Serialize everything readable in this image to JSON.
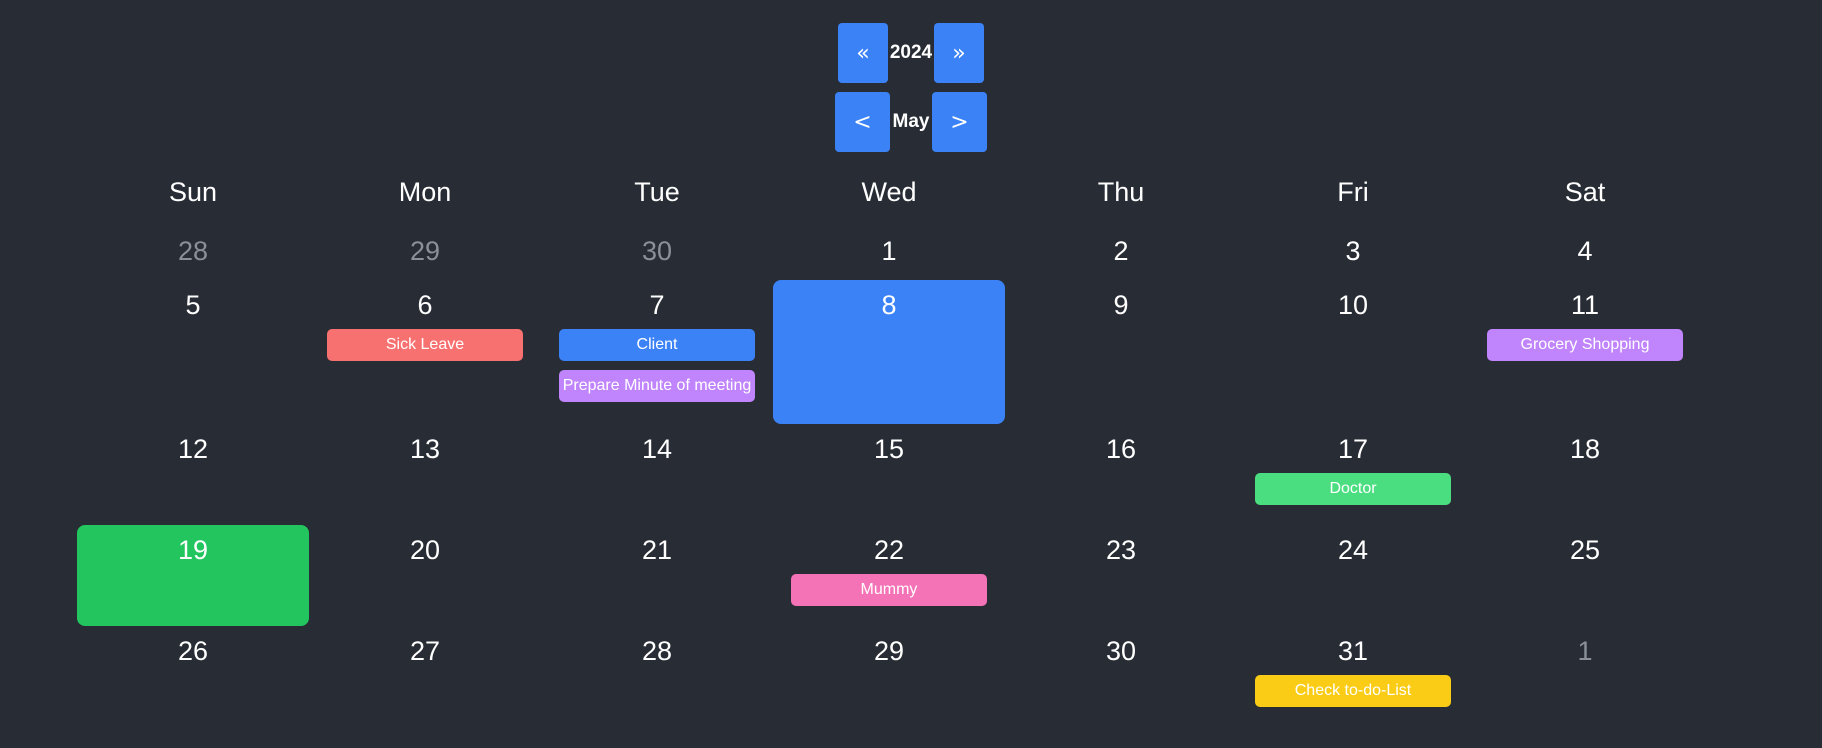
{
  "nav": {
    "prev_year": "«",
    "year": "2024",
    "next_year": "»",
    "prev_month": "<",
    "month": "May",
    "next_month": ">"
  },
  "weekdays": [
    "Sun",
    "Mon",
    "Tue",
    "Wed",
    "Thu",
    "Fri",
    "Sat"
  ],
  "colors": {
    "background": "#282c34",
    "accent": "#3b82f6",
    "today": "#22c55e",
    "muted_text": "#8a9099"
  },
  "weeks": [
    [
      {
        "day": "28",
        "muted": true
      },
      {
        "day": "29",
        "muted": true
      },
      {
        "day": "30",
        "muted": true
      },
      {
        "day": "1"
      },
      {
        "day": "2"
      },
      {
        "day": "3"
      },
      {
        "day": "4"
      }
    ],
    [
      {
        "day": "5"
      },
      {
        "day": "6",
        "events": [
          {
            "title": "Sick Leave",
            "color": "#f87171"
          }
        ]
      },
      {
        "day": "7",
        "events": [
          {
            "title": "Client",
            "color": "#3b82f6"
          },
          {
            "title": "Prepare Minute of meeting",
            "color": "#c084fc"
          }
        ]
      },
      {
        "day": "8",
        "state": "selected"
      },
      {
        "day": "9"
      },
      {
        "day": "10"
      },
      {
        "day": "11",
        "events": [
          {
            "title": "Grocery Shopping",
            "color": "#c084fc"
          }
        ]
      }
    ],
    [
      {
        "day": "12"
      },
      {
        "day": "13"
      },
      {
        "day": "14"
      },
      {
        "day": "15"
      },
      {
        "day": "16"
      },
      {
        "day": "17",
        "events": [
          {
            "title": "Doctor",
            "color": "#4ade80"
          }
        ]
      },
      {
        "day": "18"
      }
    ],
    [
      {
        "day": "19",
        "state": "today"
      },
      {
        "day": "20"
      },
      {
        "day": "21"
      },
      {
        "day": "22",
        "events": [
          {
            "title": "Mummy",
            "color": "#f472b6"
          }
        ]
      },
      {
        "day": "23"
      },
      {
        "day": "24"
      },
      {
        "day": "25"
      }
    ],
    [
      {
        "day": "26"
      },
      {
        "day": "27"
      },
      {
        "day": "28"
      },
      {
        "day": "29"
      },
      {
        "day": "30"
      },
      {
        "day": "31",
        "events": [
          {
            "title": "Check to-do-List",
            "color": "#facc15"
          }
        ]
      },
      {
        "day": "1",
        "muted": true
      }
    ]
  ]
}
